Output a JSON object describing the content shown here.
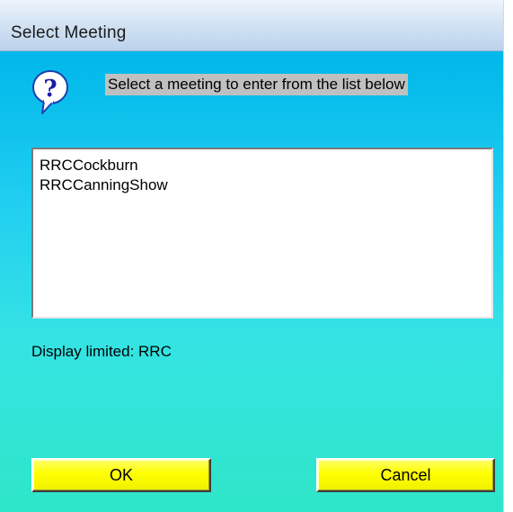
{
  "window": {
    "title": "Select Meeting"
  },
  "dialog": {
    "icon": "question-balloon-icon",
    "prompt": "Select a meeting to enter from the list below",
    "meetings": [
      "RRCCockburn",
      "RRCCanningShow"
    ],
    "display_limited": "Display limited: RRC"
  },
  "buttons": {
    "ok": "OK",
    "cancel": "Cancel"
  },
  "colors": {
    "client_top": "#00b7ea",
    "client_bottom": "#2ee6c8",
    "button_yellow": "#ffff00",
    "prompt_background": "#c0c0c0"
  }
}
